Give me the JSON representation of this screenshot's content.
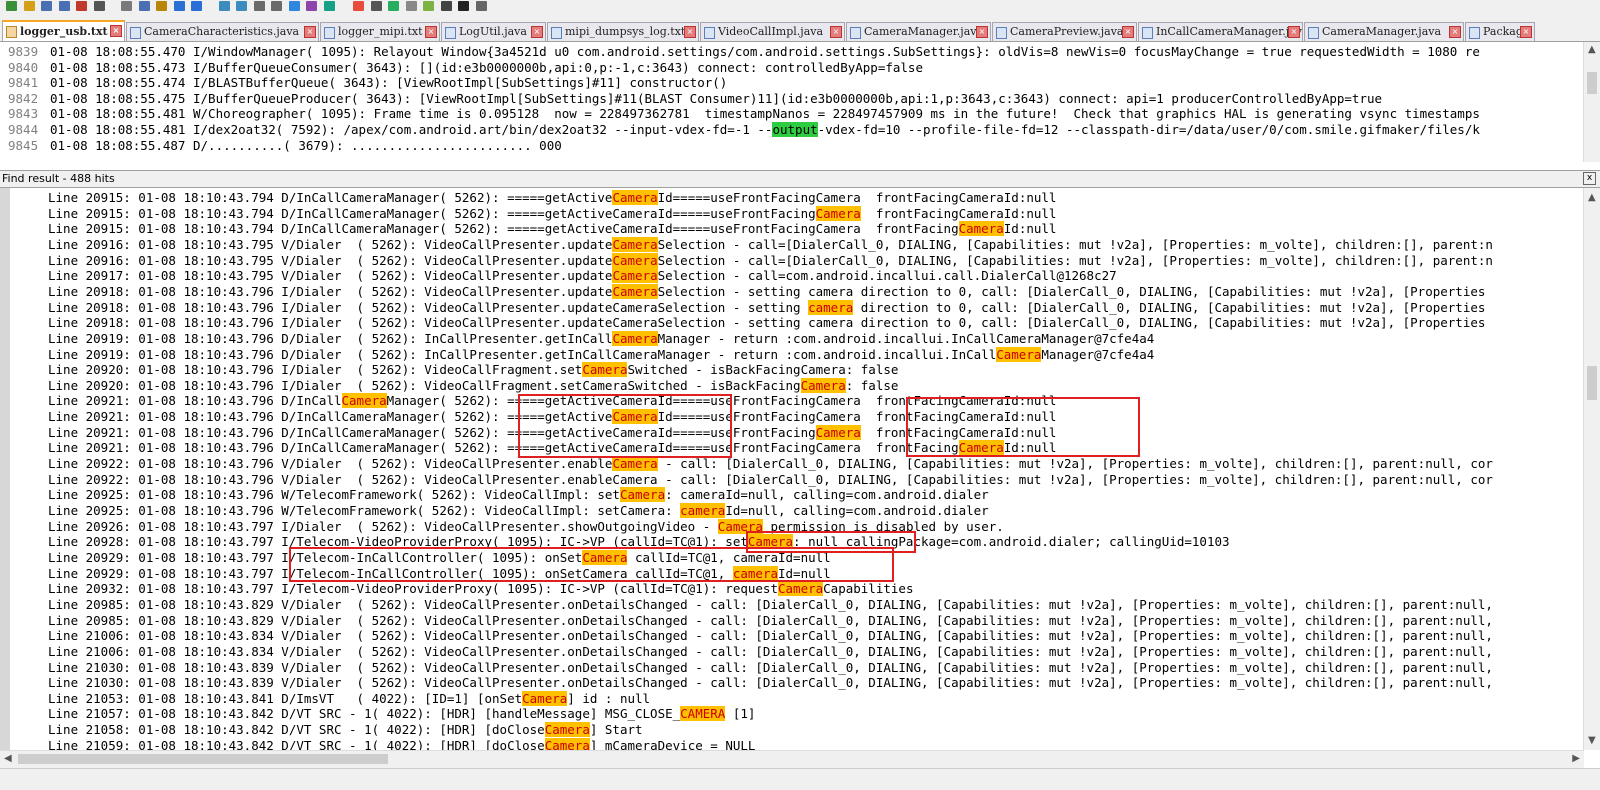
{
  "toolbar": {
    "icons": [
      "new-file-icon",
      "open-file-icon",
      "save-icon",
      "save-all-icon",
      "close-icon",
      "print-icon",
      "cut-icon",
      "copy-icon",
      "paste-icon",
      "undo-icon",
      "redo-icon",
      "find-icon",
      "replace-icon",
      "zoom-in-icon",
      "zoom-out-icon",
      "sync-icon",
      "wrap-icon",
      "indent-icon",
      "record-icon",
      "stop-icon",
      "play-icon",
      "run-icon",
      "android-icon",
      "device-icon",
      "logcat-icon",
      "settings-icon"
    ]
  },
  "tabs": [
    {
      "label": "logger_usb.txt",
      "active": true
    },
    {
      "label": "CameraCharacteristics.java",
      "active": false
    },
    {
      "label": "logger_mipi.txt",
      "active": false
    },
    {
      "label": "LogUtil.java",
      "active": false
    },
    {
      "label": "mipi_dumpsys_log.txt",
      "active": false
    },
    {
      "label": "VideoCallImpl.java",
      "active": false
    },
    {
      "label": "CameraManager.java",
      "active": false
    },
    {
      "label": "CameraPreview.java",
      "active": false
    },
    {
      "label": "InCallCameraManager.java",
      "active": false
    },
    {
      "label": "CameraManager.java",
      "active": false
    },
    {
      "label": "Package",
      "active": false
    }
  ],
  "editor": {
    "lines": [
      {
        "num": "9839",
        "text": "01-08 18:08:55.470 I/WindowManager( 1095): Relayout Window{3a4521d u0 com.android.settings/com.android.settings.SubSettings}: oldVis=8 newVis=0 focusMayChange = true requestedWidth = 1080 re"
      },
      {
        "num": "9840",
        "text": "01-08 18:08:55.473 I/BufferQueueConsumer( 3643): [](id:e3b0000000b,api:0,p:-1,c:3643) connect: controlledByApp=false"
      },
      {
        "num": "9841",
        "text": "01-08 18:08:55.474 I/BLASTBufferQueue( 3643): [ViewRootImpl[SubSettings]#11] constructor()"
      },
      {
        "num": "9842",
        "text": "01-08 18:08:55.475 I/BufferQueueProducer( 3643): [ViewRootImpl[SubSettings]#11(BLAST Consumer)11](id:e3b0000000b,api:1,p:3643,c:3643) connect: api=1 producerControlledByApp=true"
      },
      {
        "num": "9843",
        "text": "01-08 18:08:55.481 W/Choreographer( 1095): Frame time is 0.095128  now = 228497362781  timestampNanos = 228497457909 ms in the future!  Check that graphics HAL is generating vsync timestamps"
      },
      {
        "num": "9844",
        "pre": "01-08 18:08:55.481 I/dex2oat32( 7592): /apex/com.android.art/bin/dex2oat32 --input-vdex-fd=-1 --",
        "match": "output",
        "post": "-vdex-fd=10 --profile-file-fd=12 --classpath-dir=/data/user/0/com.smile.gifmaker/files/k"
      },
      {
        "num": "9845",
        "text": "01-08 18:08:55.487 D/..........( 3679): ........................ 000"
      }
    ]
  },
  "find": {
    "title": "Find result - 488 hits",
    "close_label": "x",
    "results": [
      [
        {
          "t": "Line 20915: 01-08 18:10:43.794 D/InCallCameraManager( 5262): =====getActive"
        },
        {
          "h": "Camera"
        },
        {
          "t": "Id=====useFrontFacingCamera  frontFacingCameraId:null"
        }
      ],
      [
        {
          "t": "Line 20915: 01-08 18:10:43.794 D/InCallCameraManager( 5262): =====getActiveCameraId=====useFrontFacing"
        },
        {
          "h": "Camera"
        },
        {
          "t": "  frontFacingCameraId:null"
        }
      ],
      [
        {
          "t": "Line 20915: 01-08 18:10:43.794 D/InCallCameraManager( 5262): =====getActiveCameraId=====useFrontFacingCamera  frontFacing"
        },
        {
          "h": "Camera"
        },
        {
          "t": "Id:null"
        }
      ],
      [
        {
          "t": "Line 20916: 01-08 18:10:43.795 V/Dialer  ( 5262): VideoCallPresenter.update"
        },
        {
          "h": "Camera"
        },
        {
          "t": "Selection - call=[DialerCall_0, DIALING, [Capabilities: mut !v2a], [Properties: m_volte], children:[], parent:n"
        }
      ],
      [
        {
          "t": "Line 20916: 01-08 18:10:43.795 V/Dialer  ( 5262): VideoCallPresenter.update"
        },
        {
          "h": "Camera"
        },
        {
          "t": "Selection - call=[DialerCall_0, DIALING, [Capabilities: mut !v2a], [Properties: m_volte], children:[], parent:n"
        }
      ],
      [
        {
          "t": "Line 20917: 01-08 18:10:43.795 V/Dialer  ( 5262): VideoCallPresenter.update"
        },
        {
          "h": "Camera"
        },
        {
          "t": "Selection - call=com.android.incallui.call.DialerCall@1268c27"
        }
      ],
      [
        {
          "t": "Line 20918: 01-08 18:10:43.796 I/Dialer  ( 5262): VideoCallPresenter.update"
        },
        {
          "h": "Camera"
        },
        {
          "t": "Selection - setting camera direction to 0, call: [DialerCall_0, DIALING, [Capabilities: mut !v2a], [Properties"
        }
      ],
      [
        {
          "t": "Line 20918: 01-08 18:10:43.796 I/Dialer  ( 5262): VideoCallPresenter.updateCameraSelection - setting "
        },
        {
          "h": "camera"
        },
        {
          "t": " direction to 0, call: [DialerCall_0, DIALING, [Capabilities: mut !v2a], [Properties"
        }
      ],
      [
        {
          "t": "Line 20918: 01-08 18:10:43.796 I/Dialer  ( 5262): VideoCallPresenter.updateCameraSelection - setting camera direction to 0, call: [DialerCall_0, DIALING, [Capabilities: mut !v2a], [Properties"
        }
      ],
      [
        {
          "t": "Line 20919: 01-08 18:10:43.796 D/Dialer  ( 5262): InCallPresenter.getInCall"
        },
        {
          "h": "Camera"
        },
        {
          "t": "Manager - return :com.android.incallui.InCallCameraManager@7cfe4a4"
        }
      ],
      [
        {
          "t": "Line 20919: 01-08 18:10:43.796 D/Dialer  ( 5262): InCallPresenter.getInCallCameraManager - return :com.android.incallui.InCall"
        },
        {
          "h": "Camera"
        },
        {
          "t": "Manager@7cfe4a4"
        }
      ],
      [
        {
          "t": "Line 20920: 01-08 18:10:43.796 I/Dialer  ( 5262): VideoCallFragment.set"
        },
        {
          "h": "Camera"
        },
        {
          "t": "Switched - isBackFacingCamera: false"
        }
      ],
      [
        {
          "t": "Line 20920: 01-08 18:10:43.796 I/Dialer  ( 5262): VideoCallFragment.setCameraSwitched - isBackFacing"
        },
        {
          "h": "Camera"
        },
        {
          "t": ": false"
        }
      ],
      [
        {
          "t": "Line 20921: 01-08 18:10:43.796 D/InCall"
        },
        {
          "h": "Camera"
        },
        {
          "t": "Manager( 5262): =====getActiveCameraId=====useFrontFacingCamera  frontFacingCameraId:null"
        }
      ],
      [
        {
          "t": "Line 20921: 01-08 18:10:43.796 D/InCallCameraManager( 5262): =====getActive"
        },
        {
          "h": "Camera"
        },
        {
          "t": "Id=====useFrontFacingCamera  frontFacingCameraId:null"
        }
      ],
      [
        {
          "t": "Line 20921: 01-08 18:10:43.796 D/InCallCameraManager( 5262): =====getActiveCameraId=====useFrontFacing"
        },
        {
          "h": "Camera"
        },
        {
          "t": "  frontFacingCameraId:null"
        }
      ],
      [
        {
          "t": "Line 20921: 01-08 18:10:43.796 D/InCallCameraManager( 5262): =====getActiveCameraId=====useFrontFacingCamera  frontFacing"
        },
        {
          "h": "Camera"
        },
        {
          "t": "Id:null"
        }
      ],
      [
        {
          "t": "Line 20922: 01-08 18:10:43.796 V/Dialer  ( 5262): VideoCallPresenter.enable"
        },
        {
          "h": "Camera"
        },
        {
          "t": " - call: [DialerCall_0, DIALING, [Capabilities: mut !v2a], [Properties: m_volte], children:[], parent:null, cor"
        }
      ],
      [
        {
          "t": "Line 20922: 01-08 18:10:43.796 V/Dialer  ( 5262): VideoCallPresenter.enableCamera - call: [DialerCall_0, DIALING, [Capabilities: mut !v2a], [Properties: m_volte], children:[], parent:null, cor"
        }
      ],
      [
        {
          "t": "Line 20925: 01-08 18:10:43.796 W/TelecomFramework( 5262): VideoCallImpl: set"
        },
        {
          "h": "Camera"
        },
        {
          "t": ": cameraId=null, calling=com.android.dialer"
        }
      ],
      [
        {
          "t": "Line 20925: 01-08 18:10:43.796 W/TelecomFramework( 5262): VideoCallImpl: setCamera: "
        },
        {
          "h": "camera"
        },
        {
          "t": "Id=null, calling=com.android.dialer"
        }
      ],
      [
        {
          "t": "Line 20926: 01-08 18:10:43.797 I/Dialer  ( 5262): VideoCallPresenter.showOutgoingVideo - "
        },
        {
          "h": "Camera"
        },
        {
          "t": " permission is disabled by user."
        }
      ],
      [
        {
          "t": "Line 20928: 01-08 18:10:43.797 I/Telecom-VideoProviderProxy( 1095): IC->VP (callId=TC@1): set"
        },
        {
          "h": "Camera"
        },
        {
          "t": ": null callingPackage=com.android.dialer; callingUid=10103"
        }
      ],
      [
        {
          "t": "Line 20929: 01-08 18:10:43.797 I/Telecom-InCallController( 1095): onSet"
        },
        {
          "h": "Camera"
        },
        {
          "t": " callId=TC@1, cameraId=null"
        }
      ],
      [
        {
          "t": "Line 20929: 01-08 18:10:43.797 I/Telecom-InCallController( 1095): onSetCamera callId=TC@1, "
        },
        {
          "h": "camera"
        },
        {
          "t": "Id=null"
        }
      ],
      [
        {
          "t": "Line 20932: 01-08 18:10:43.797 I/Telecom-VideoProviderProxy( 1095): IC->VP (callId=TC@1): request"
        },
        {
          "h": "Camera"
        },
        {
          "t": "Capabilities"
        }
      ],
      [
        {
          "t": "Line 20985: 01-08 18:10:43.829 V/Dialer  ( 5262): VideoCallPresenter.onDetailsChanged - call: [DialerCall_0, DIALING, [Capabilities: mut !v2a], [Properties: m_volte], children:[], parent:null,"
        }
      ],
      [
        {
          "t": "Line 20985: 01-08 18:10:43.829 V/Dialer  ( 5262): VideoCallPresenter.onDetailsChanged - call: [DialerCall_0, DIALING, [Capabilities: mut !v2a], [Properties: m_volte], children:[], parent:null,"
        }
      ],
      [
        {
          "t": "Line 21006: 01-08 18:10:43.834 V/Dialer  ( 5262): VideoCallPresenter.onDetailsChanged - call: [DialerCall_0, DIALING, [Capabilities: mut !v2a], [Properties: m_volte], children:[], parent:null,"
        }
      ],
      [
        {
          "t": "Line 21006: 01-08 18:10:43.834 V/Dialer  ( 5262): VideoCallPresenter.onDetailsChanged - call: [DialerCall_0, DIALING, [Capabilities: mut !v2a], [Properties: m_volte], children:[], parent:null,"
        }
      ],
      [
        {
          "t": "Line 21030: 01-08 18:10:43.839 V/Dialer  ( 5262): VideoCallPresenter.onDetailsChanged - call: [DialerCall_0, DIALING, [Capabilities: mut !v2a], [Properties: m_volte], children:[], parent:null,"
        }
      ],
      [
        {
          "t": "Line 21030: 01-08 18:10:43.839 V/Dialer  ( 5262): VideoCallPresenter.onDetailsChanged - call: [DialerCall_0, DIALING, [Capabilities: mut !v2a], [Properties: m_volte], children:[], parent:null,"
        }
      ],
      [
        {
          "t": "Line 21053: 01-08 18:10:43.841 D/ImsVT   ( 4022): [ID=1] [onSet"
        },
        {
          "h": "Camera"
        },
        {
          "t": "] id : null"
        }
      ],
      [
        {
          "t": "Line 21057: 01-08 18:10:43.842 D/VT SRC - 1( 4022): [HDR] [handleMessage] MSG_CLOSE_"
        },
        {
          "h": "CAMERA"
        },
        {
          "t": " [1]"
        }
      ],
      [
        {
          "t": "Line 21058: 01-08 18:10:43.842 D/VT SRC - 1( 4022): [HDR] [doClose"
        },
        {
          "h": "Camera"
        },
        {
          "t": "] Start"
        }
      ],
      [
        {
          "t": "Line 21059: 01-08 18:10:43.842 D/VT SRC - 1( 4022): [HDR] [doClose"
        },
        {
          "h": "Camera"
        },
        {
          "t": "] mCameraDevice = NULL"
        }
      ]
    ]
  }
}
